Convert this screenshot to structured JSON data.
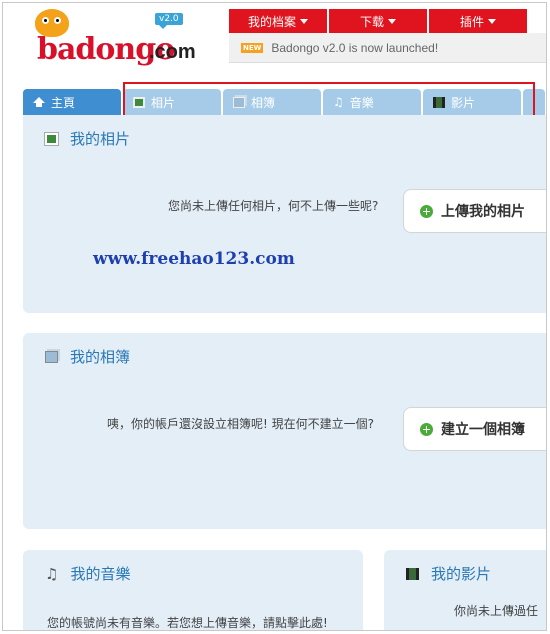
{
  "brand": {
    "logo_text": "badongo",
    "logo_suffix": ".com",
    "version_badge": "v2.0"
  },
  "topmenu": {
    "items": [
      {
        "label": "我的档案"
      },
      {
        "label": "下载"
      },
      {
        "label": "插件"
      }
    ]
  },
  "news": {
    "badge": "NEW",
    "text": "Badongo v2.0 is now launched!"
  },
  "tabs": [
    {
      "label": "主頁",
      "icon": "home-icon"
    },
    {
      "label": "相片",
      "icon": "photo-icon"
    },
    {
      "label": "相簿",
      "icon": "album-icon"
    },
    {
      "label": "音樂",
      "icon": "music-icon"
    },
    {
      "label": "影片",
      "icon": "film-icon"
    }
  ],
  "panels": {
    "photos": {
      "title": "我的相片",
      "message": "您尚未上傳任何相片，何不上傳一些呢?",
      "button": "上傳我的相片"
    },
    "albums": {
      "title": "我的相簿",
      "message": "咦，你的帳戶還沒設立相簿呢! 現在何不建立一個?",
      "button": "建立一個相簿"
    },
    "music": {
      "title": "我的音樂",
      "message": "您的帳號尚未有音樂。若您想上傳音樂，請點擊此處!"
    },
    "videos": {
      "title": "我的影片",
      "message": "你尚未上傳過任"
    }
  },
  "watermark": "www.freehao123.com",
  "colors": {
    "brand_red": "#e0141e",
    "tab_active": "#3f8ed2",
    "tab_inactive": "#a6cbe8",
    "panel_bg": "#e3eef7",
    "title_blue": "#2a78b5",
    "highlight": "#e0141e"
  }
}
